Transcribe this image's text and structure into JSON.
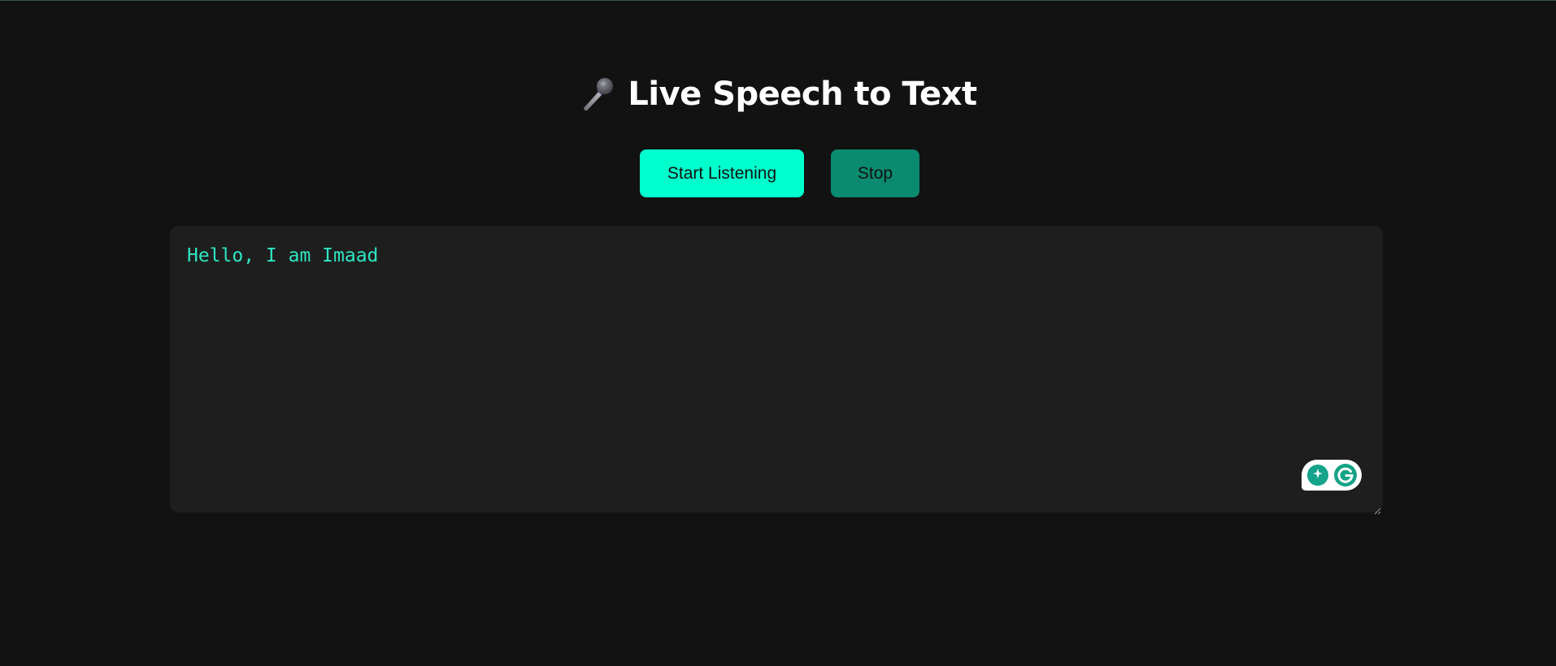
{
  "page": {
    "title": "Live Speech to Text",
    "title_icon": "microphone-icon"
  },
  "controls": {
    "start_label": "Start Listening",
    "stop_label": "Stop"
  },
  "output": {
    "transcript": "Hello, I am Imaad"
  },
  "extension": {
    "icons": [
      "lightbulb-icon",
      "grammarly-g-icon"
    ]
  },
  "colors": {
    "background": "#121212",
    "panel": "#1e1e1e",
    "accent": "#00ffcc",
    "accent_dark": "#0a8a6e",
    "transcript_text": "#2ee6c2",
    "title_text": "#ffffff"
  }
}
